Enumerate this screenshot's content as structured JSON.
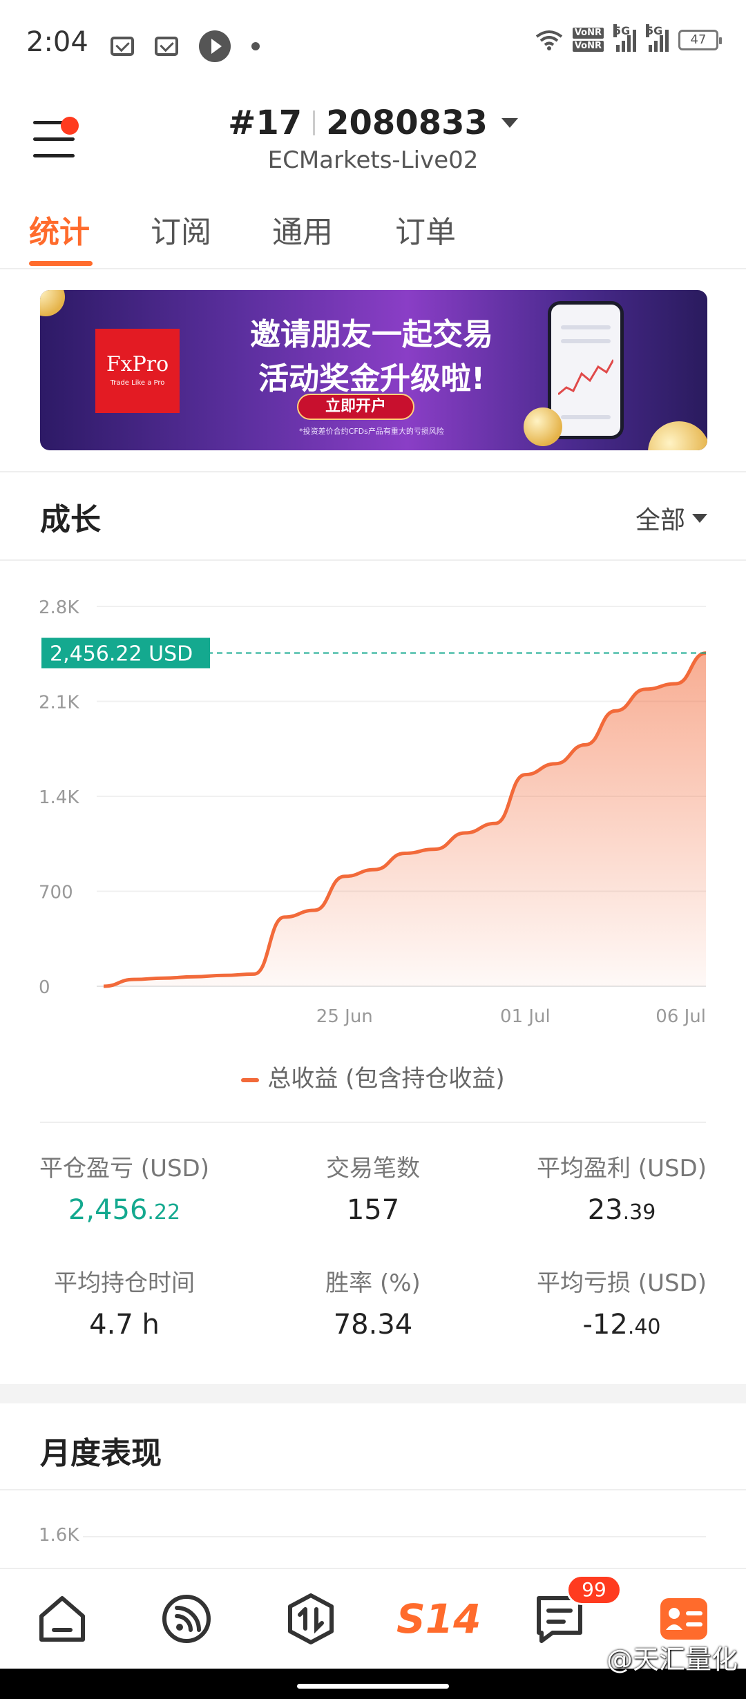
{
  "status_bar": {
    "time": "2:04",
    "network_tags": [
      "VoNR",
      "VoNR"
    ],
    "signal_labels": [
      "5G",
      "5G"
    ],
    "battery": "47"
  },
  "header": {
    "account_number": "#17",
    "account_id": "2080833",
    "server": "ECMarkets-Live02"
  },
  "tabs": [
    {
      "label": "统计",
      "active": true
    },
    {
      "label": "订阅",
      "active": false
    },
    {
      "label": "通用",
      "active": false
    },
    {
      "label": "订单",
      "active": false
    }
  ],
  "banner": {
    "brand": "FxPro",
    "brand_tagline": "Trade Like a Pro",
    "headline_1": "邀请朋友一起交易",
    "headline_2": "活动奖金升级啦!",
    "cta": "立即开户",
    "disclaimer": "*投资差价合约CFDs产品有重大的亏损风险"
  },
  "growth": {
    "title": "成长",
    "range": "全部",
    "current_value_label": "2,456.22 USD",
    "legend": "总收益 (包含持仓收益)"
  },
  "chart_data": {
    "type": "area",
    "series": [
      {
        "name": "总收益 (包含持仓收益)",
        "color": "#f26a3a",
        "x": [
          "2024-06-17",
          "2024-06-18",
          "2024-06-19",
          "2024-06-20",
          "2024-06-21",
          "2024-06-22",
          "2024-06-23",
          "2024-06-24",
          "2024-06-25",
          "2024-06-26",
          "2024-06-27",
          "2024-06-28",
          "2024-06-29",
          "2024-06-30",
          "2024-07-01",
          "2024-07-02",
          "2024-07-03",
          "2024-07-04",
          "2024-07-05",
          "2024-07-06",
          "2024-07-07"
        ],
        "values": [
          0,
          50,
          60,
          70,
          80,
          90,
          510,
          560,
          810,
          860,
          980,
          1010,
          1130,
          1200,
          1560,
          1640,
          1780,
          2030,
          2190,
          2230,
          2456
        ]
      }
    ],
    "y_ticks": [
      "2.8K",
      "2.1K",
      "1.4K",
      "700",
      "0"
    ],
    "y_tick_values": [
      2800,
      2100,
      1400,
      700,
      0
    ],
    "x_ticks": [
      "25 Jun",
      "01 Jul",
      "06 Jul"
    ],
    "x_tick_dates": [
      "2024-06-25",
      "2024-07-01",
      "2024-07-06"
    ],
    "ylim": [
      0,
      2800
    ],
    "reference_line": {
      "value": 2456.22,
      "label": "2,456.22 USD",
      "color": "#14a98f"
    },
    "grid": true,
    "legend_position": "bottom"
  },
  "stats": [
    {
      "label": "平仓盈亏 (USD)",
      "int": "2,456",
      "dec": ".22",
      "color": "green"
    },
    {
      "label": "交易笔数",
      "int": "157",
      "dec": "",
      "color": "default"
    },
    {
      "label": "平均盈利 (USD)",
      "int": "23",
      "dec": ".39",
      "color": "default"
    },
    {
      "label": "平均持仓时间",
      "int": "4.7 h",
      "dec": "",
      "color": "default"
    },
    {
      "label": "胜率 (%)",
      "int": "78.34",
      "dec": "",
      "color": "default"
    },
    {
      "label": "平均亏损 (USD)",
      "int": "-12",
      "dec": ".40",
      "color": "default"
    }
  ],
  "monthly": {
    "title": "月度表现",
    "first_tick": "1.6K"
  },
  "bottom_nav": {
    "items": [
      "home-icon",
      "feed-icon",
      "trade-icon",
      "s14-icon",
      "messages-icon",
      "profile-icon"
    ],
    "s14_label": "S14",
    "messages_badge": "99",
    "accent": "#ff6b2c"
  },
  "watermark": "@天汇量化"
}
